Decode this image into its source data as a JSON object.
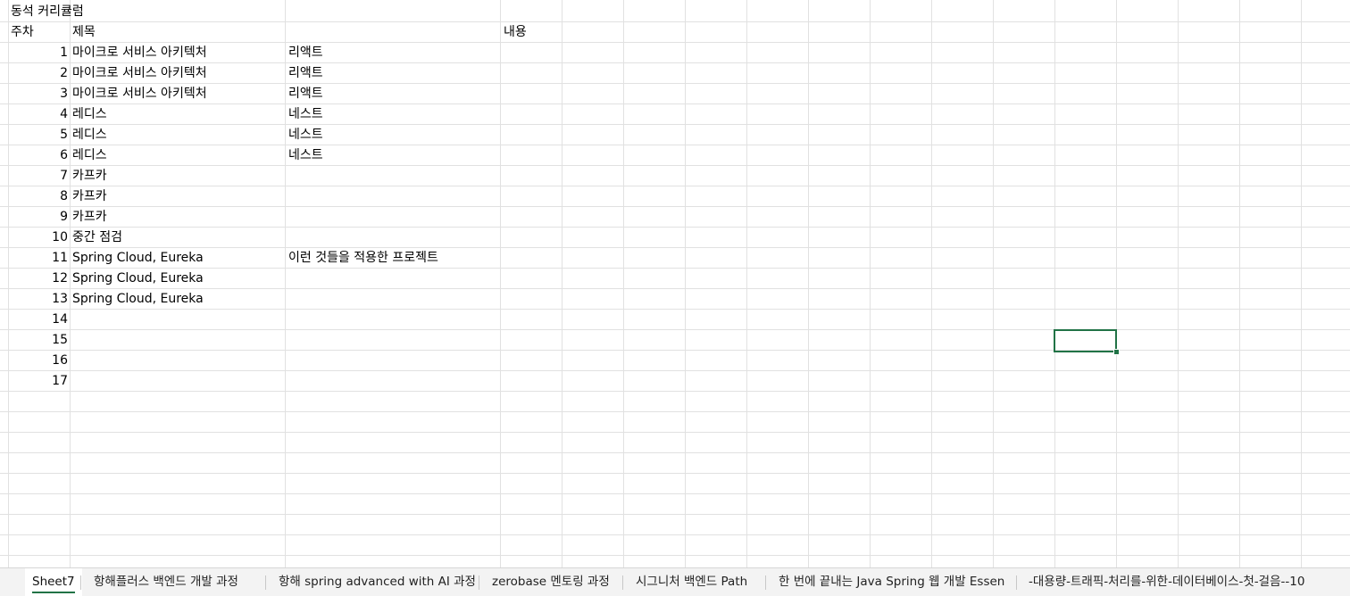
{
  "sheet": {
    "title": "동석 커리큘럼",
    "headers": {
      "week": "주차",
      "title": "제목",
      "content": "내용"
    },
    "rows": [
      {
        "week": "1",
        "title": "마이크로 서비스 아키텍처",
        "sub": "리액트"
      },
      {
        "week": "2",
        "title": "마이크로 서비스 아키텍처",
        "sub": "리액트"
      },
      {
        "week": "3",
        "title": "마이크로 서비스 아키텍처",
        "sub": "리액트"
      },
      {
        "week": "4",
        "title": "레디스",
        "sub": "네스트"
      },
      {
        "week": "5",
        "title": "레디스",
        "sub": "네스트"
      },
      {
        "week": "6",
        "title": "레디스",
        "sub": "네스트"
      },
      {
        "week": "7",
        "title": "카프카",
        "sub": ""
      },
      {
        "week": "8",
        "title": "카프카",
        "sub": ""
      },
      {
        "week": "9",
        "title": "카프카",
        "sub": ""
      },
      {
        "week": "10",
        "title": "중간 점검",
        "sub": ""
      },
      {
        "week": "11",
        "title": "Spring Cloud, Eureka",
        "sub": "이런 것들을 적용한 프로젝트"
      },
      {
        "week": "12",
        "title": "Spring Cloud, Eureka",
        "sub": ""
      },
      {
        "week": "13",
        "title": "Spring Cloud, Eureka",
        "sub": ""
      },
      {
        "week": "14",
        "title": "",
        "sub": ""
      },
      {
        "week": "15",
        "title": "",
        "sub": ""
      },
      {
        "week": "16",
        "title": "",
        "sub": ""
      },
      {
        "week": "17",
        "title": "",
        "sub": ""
      }
    ]
  },
  "tabs": [
    {
      "label": "Sheet7",
      "active": true
    },
    {
      "label": "항해플러스 백엔드 개발 과정",
      "active": false
    },
    {
      "label": "항해 spring advanced with AI 과정",
      "active": false
    },
    {
      "label": "zerobase 멘토링 과정",
      "active": false
    },
    {
      "label": "시그니처 백엔드 Path",
      "active": false
    },
    {
      "label": "한 번에 끝내는 Java Spring 웹 개발 Essen",
      "active": false
    },
    {
      "label": "-대용량-트래픽-처리를-위한-데이터베이스-첫-걸음--10",
      "active": false
    }
  ],
  "colors": {
    "accent": "#217346",
    "gridline": "#e1e1e1",
    "tabbar": "#f3f3f3"
  }
}
